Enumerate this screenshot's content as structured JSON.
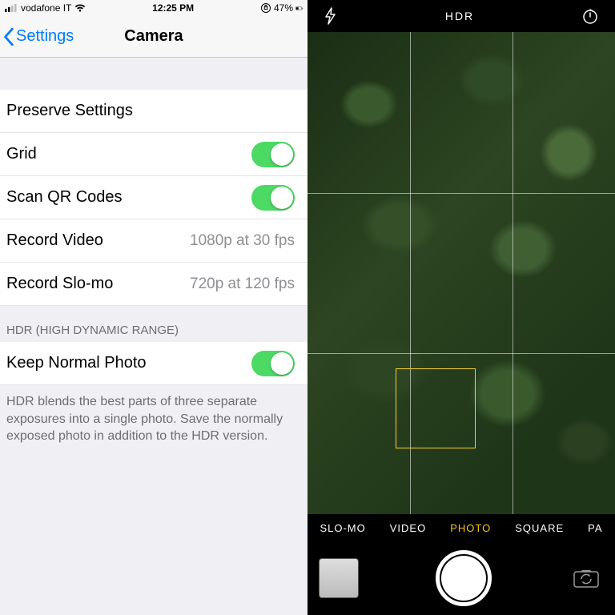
{
  "status": {
    "carrier": "vodafone IT",
    "time": "12:25 PM",
    "battery_pct": "47%"
  },
  "nav": {
    "back_label": "Settings",
    "title": "Camera"
  },
  "rows": {
    "preserve": "Preserve Settings",
    "grid": "Grid",
    "qr": "Scan QR Codes",
    "record_video": "Record Video",
    "record_video_val": "1080p at 30 fps",
    "record_slomo": "Record Slo-mo",
    "record_slomo_val": "720p at 120 fps",
    "keep_normal": "Keep Normal Photo"
  },
  "sections": {
    "hdr_header": "HDR (HIGH DYNAMIC RANGE)",
    "hdr_footer": "HDR blends the best parts of three separate exposures into a single photo. Save the normally exposed photo in addition to the HDR version."
  },
  "toggles": {
    "grid": true,
    "qr": true,
    "keep_normal": true
  },
  "camera": {
    "hdr": "HDR",
    "modes": {
      "slomo": "SLO-MO",
      "video": "VIDEO",
      "photo": "PHOTO",
      "square": "SQUARE",
      "pano": "PA"
    },
    "selected_mode": "PHOTO"
  }
}
